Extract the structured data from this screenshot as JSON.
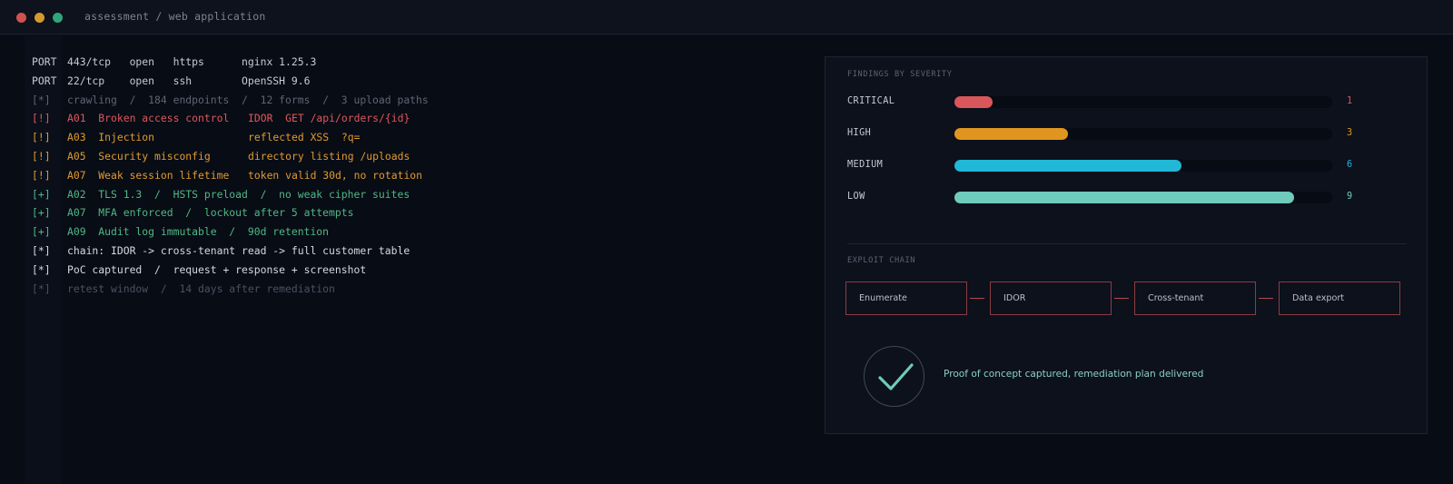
{
  "window": {
    "title": "assessment / web application",
    "dot_colors": [
      "#d0524f",
      "#d49a2e",
      "#2fa57a"
    ]
  },
  "log": [
    {
      "tag": "PORT",
      "c1": "443/tcp   open   https      nginx 1.25.3",
      "c2": "",
      "color": "#c5cbd6",
      "tag_color": "#c5cbd6"
    },
    {
      "tag": "PORT",
      "c1": "22/tcp    open   ssh        OpenSSH 9.6",
      "c2": "",
      "color": "#c5cbd6",
      "tag_color": "#c5cbd6"
    },
    {
      "tag": "[*]",
      "c1": "crawling  /  184 endpoints  /  12 forms  /  3 upload paths",
      "c2": "",
      "color": "#5d6574",
      "tag_color": "#5d6574"
    },
    {
      "tag": "[!]",
      "c1": "A01  Broken access control",
      "c2": "IDOR  GET /api/orders/{id}",
      "color": "#e0575a",
      "tag_color": "#e0575a"
    },
    {
      "tag": "[!]",
      "c1": "A03  Injection",
      "c2": "reflected XSS  ?q=",
      "color": "#e09a30",
      "tag_color": "#e09a30"
    },
    {
      "tag": "[!]",
      "c1": "A05  Security misconfig",
      "c2": "directory listing /uploads",
      "color": "#e09a30",
      "tag_color": "#e09a30"
    },
    {
      "tag": "[!]",
      "c1": "A07  Weak session lifetime",
      "c2": "token valid 30d, no rotation",
      "color": "#e09a30",
      "tag_color": "#e09a30"
    },
    {
      "tag": "[+]",
      "c1": "A02  TLS 1.3  /  HSTS preload  /  no weak cipher suites",
      "c2": "",
      "color": "#4fb886",
      "tag_color": "#4fb886"
    },
    {
      "tag": "[+]",
      "c1": "A07  MFA enforced  /  lockout after 5 attempts",
      "c2": "",
      "color": "#4fb886",
      "tag_color": "#4fb886"
    },
    {
      "tag": "[+]",
      "c1": "A09  Audit log immutable  /  90d retention",
      "c2": "",
      "color": "#4fb886",
      "tag_color": "#4fb886"
    },
    {
      "tag": "[*]",
      "c1": "chain: IDOR -> cross-tenant read -> full customer table",
      "c2": "",
      "color": "#d3dae4",
      "tag_color": "#d3dae4"
    },
    {
      "tag": "[*]",
      "c1": "PoC captured  /  request + response + screenshot",
      "c2": "",
      "color": "#d3dae4",
      "tag_color": "#d3dae4"
    },
    {
      "tag": "[*]",
      "c1": "retest window  /  14 days after remediation",
      "c2": "",
      "color": "#4a5160",
      "tag_color": "#4a5160"
    }
  ],
  "findings": {
    "label": "FINDINGS BY SEVERITY",
    "max": 10,
    "rows": [
      {
        "name": "CRITICAL",
        "count": 1,
        "display": "1",
        "color": "#d9565a"
      },
      {
        "name": "HIGH",
        "count": 3,
        "display": "3",
        "color": "#e0961e"
      },
      {
        "name": "MEDIUM",
        "count": 6,
        "display": "6",
        "color": "#21b7d6"
      },
      {
        "name": "LOW",
        "count": 9,
        "display": "9",
        "color": "#6fcbbb"
      }
    ]
  },
  "chain": {
    "label": "EXPLOIT CHAIN",
    "steps": [
      "Enumerate",
      "IDOR",
      "Cross-tenant",
      "Data export"
    ]
  },
  "poc": {
    "text": "Proof of concept captured, remediation plan delivered",
    "icon": "check-icon",
    "color": "#6fcbbb"
  }
}
